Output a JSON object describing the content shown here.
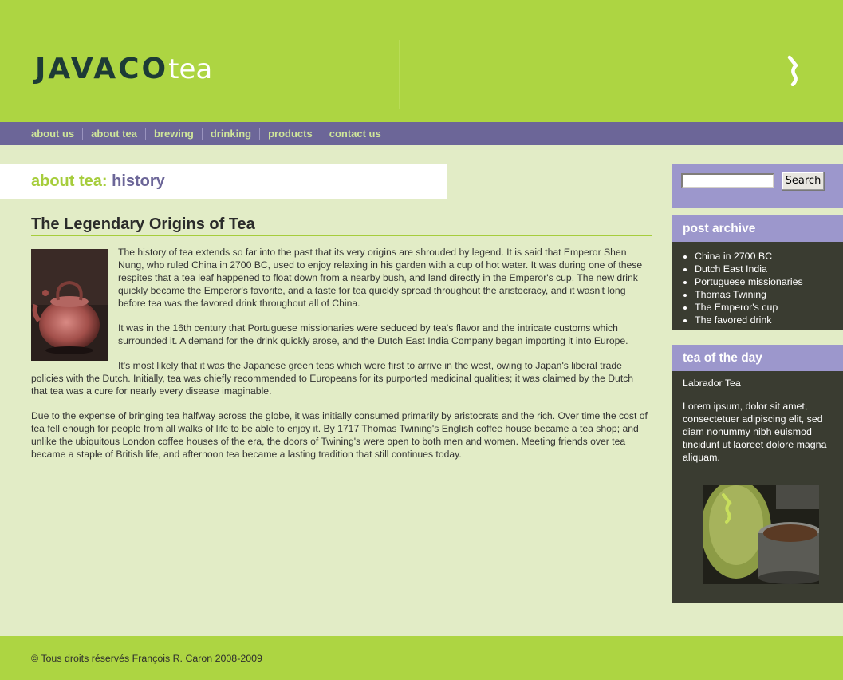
{
  "header": {
    "logo_main": "JAVACO",
    "logo_sub": "tea"
  },
  "nav": {
    "items": [
      "about us",
      "about tea",
      "brewing",
      "drinking",
      "products",
      "contact us"
    ]
  },
  "page_title": {
    "section": "about tea:",
    "subsection": "history"
  },
  "article": {
    "heading": "The Legendary Origins of Tea",
    "paragraphs": [
      "The history of tea extends so far into the past that its very origins are shrouded by legend. It is said that Emperor Shen Nung, who ruled China in 2700 BC, used to enjoy relaxing in his garden with a cup of hot water. It was during one of these respites that a tea leaf happened to float down from a nearby bush, and land directly in the Emperor's cup. The new drink quickly became the Emperor's favorite, and a taste for tea quickly spread throughout the aristocracy, and it wasn't long before tea was the favored drink throughout all of China.",
      "It was in the 16th century that Portuguese missionaries were seduced by tea's flavor and the intricate customs which surrounded it. A demand for the drink quickly arose, and the Dutch East India Company began importing it into Europe.",
      "It's most likely that it was the Japanese green teas which were first to arrive in the west, owing to Japan's liberal trade policies with the Dutch. Initially, tea was chiefly recommended to Europeans for its purported medicinal qualities; it was claimed by the Dutch that tea was a cure for nearly every disease imaginable.",
      "Due to the expense of bringing tea halfway across the globe, it was initially consumed primarily by aristocrats and the rich. Over time the cost of tea fell enough for people from all walks of life to be able to enjoy it. By 1717 Thomas Twining's English coffee house became a tea shop; and unlike the ubiquitous London coffee houses of the era, the doors of Twining's were open to both men and women. Meeting friends over tea became a staple of British life, and afternoon tea became a lasting tradition that still continues today."
    ]
  },
  "search": {
    "button_label": "Search",
    "value": ""
  },
  "archive": {
    "title": "post archive",
    "items": [
      "China in 2700 BC",
      "Dutch East India",
      "Portuguese missionaries",
      "Thomas Twining",
      "The Emperor's cup",
      "The favored drink"
    ]
  },
  "tea_of_day": {
    "title": "tea of the day",
    "name": "Labrador Tea",
    "description": "Lorem ipsum, dolor sit amet, consectetuer adipiscing elit, sed diam nonummy nibh euismod tincidunt ut laoreet dolore magna aliquam."
  },
  "footer": {
    "copyright": "© Tous droits réservés François R. Caron 2008-2009"
  },
  "colors": {
    "green": "#add542",
    "purple": "#6c6698",
    "lavender": "#9c97cc",
    "dark": "#3a3c31",
    "background": "#e2ecc6"
  }
}
